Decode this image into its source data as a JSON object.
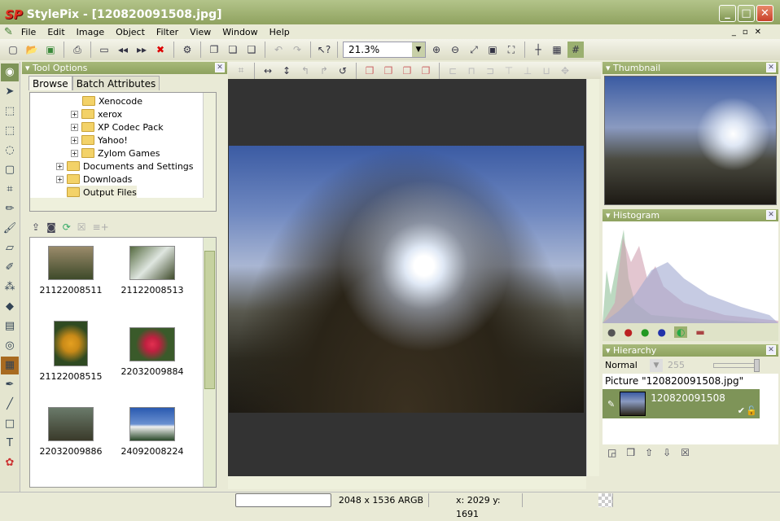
{
  "window": {
    "logo": "SP",
    "title": "StylePix - [120820091508.jpg]",
    "colors": {
      "accent": "#8fa25f",
      "canvas": "#333333"
    }
  },
  "menu": [
    "File",
    "Edit",
    "Image",
    "Object",
    "Filter",
    "View",
    "Window",
    "Help"
  ],
  "toolbar": {
    "zoom": "21.3%"
  },
  "tool_options": {
    "title": "Tool Options",
    "tabs": [
      "Browse",
      "Batch Attributes"
    ],
    "tree": [
      "Xenocode",
      "xerox",
      "XP Codec Pack",
      "Yahoo!",
      "Zylom Games",
      "Documents and Settings",
      "Downloads",
      "Output Files"
    ],
    "thumbnails": [
      "21122008511",
      "21122008513",
      "21122008515",
      "22032009884",
      "22032009886",
      "24092008224"
    ]
  },
  "panels": {
    "thumbnail": "Thumbnail",
    "histogram": "Histogram",
    "hierarchy": {
      "title": "Hierarchy",
      "blend_mode": "Normal",
      "opacity": "255",
      "picture": "Picture \"120820091508.jpg\"",
      "layer": "120820091508"
    }
  },
  "status": {
    "size": "2048 x 1536 ARGB",
    "coords": "x: 2029 y: 1691"
  }
}
